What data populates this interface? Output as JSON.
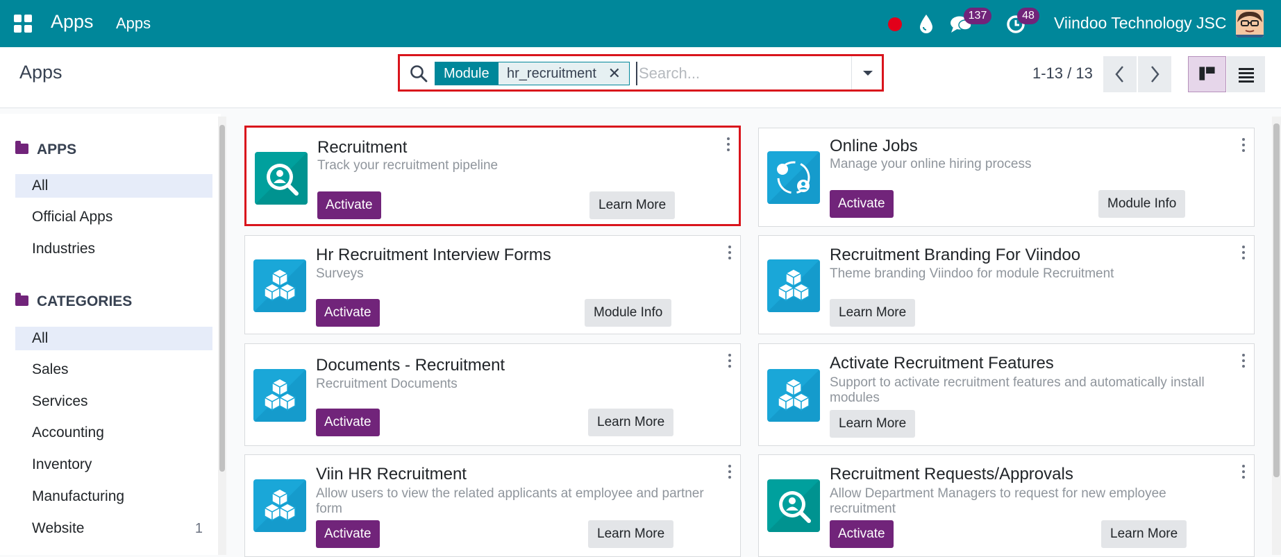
{
  "navbar": {
    "app_name": "Apps",
    "menu_item": "Apps",
    "chat_count": "137",
    "activity_count": "48",
    "company": "Viindoo Technology JSC",
    "icons": [
      "apps-grid-icon",
      "record-dot-icon",
      "water-drop-icon",
      "chat-icon",
      "clock-icon"
    ],
    "accent_color": "#00879a",
    "badge_color": "#71247a"
  },
  "control": {
    "title": "Apps",
    "facet_label": "Module",
    "facet_value": "hr_recruitment",
    "search_placeholder": "Search...",
    "pager": "1-13 / 13"
  },
  "sidebar": {
    "apps_heading": "APPS",
    "apps_items": [
      {
        "label": "All",
        "active": true
      },
      {
        "label": "Official Apps"
      },
      {
        "label": "Industries"
      }
    ],
    "categories_heading": "CATEGORIES",
    "category_items": [
      {
        "label": "All",
        "active": true
      },
      {
        "label": "Sales"
      },
      {
        "label": "Services"
      },
      {
        "label": "Accounting"
      },
      {
        "label": "Inventory"
      },
      {
        "label": "Manufacturing"
      },
      {
        "label": "Website",
        "count": "1"
      }
    ]
  },
  "cards": [
    {
      "name": "Recruitment",
      "summary": "Track your recruitment pipeline",
      "activate": "Activate",
      "secondary": "Learn More",
      "icon": "recruitment-icon"
    },
    {
      "name": "Online Jobs",
      "summary": "Manage your online hiring process",
      "activate": "Activate",
      "secondary": "Module Info",
      "icon": "online-jobs-icon"
    },
    {
      "name": "Hr Recruitment Interview Forms",
      "summary": "Surveys",
      "activate": "Activate",
      "secondary": "Module Info",
      "icon": "module-cubes-icon"
    },
    {
      "name": "Recruitment Branding For Viindoo",
      "summary": "Theme branding Viindoo for module Recruitment",
      "secondary": "Learn More",
      "icon": "module-cubes-icon"
    },
    {
      "name": "Documents - Recruitment",
      "summary": "Recruitment Documents",
      "activate": "Activate",
      "secondary": "Learn More",
      "icon": "module-cubes-icon"
    },
    {
      "name": "Activate Recruitment Features",
      "summary": "Support to activate recruitment features and automatically install modules",
      "secondary": "Learn More",
      "icon": "module-cubes-icon"
    },
    {
      "name": "Viin HR Recruitment",
      "summary": "Allow users to view the related applicants at employee and partner form",
      "activate": "Activate",
      "secondary": "Learn More",
      "icon": "module-cubes-icon"
    },
    {
      "name": "Recruitment Requests/Approvals",
      "summary": "Allow Department Managers to request for new employee recruitment",
      "activate": "Activate",
      "secondary": "Learn More",
      "icon": "recruitment-icon"
    }
  ]
}
